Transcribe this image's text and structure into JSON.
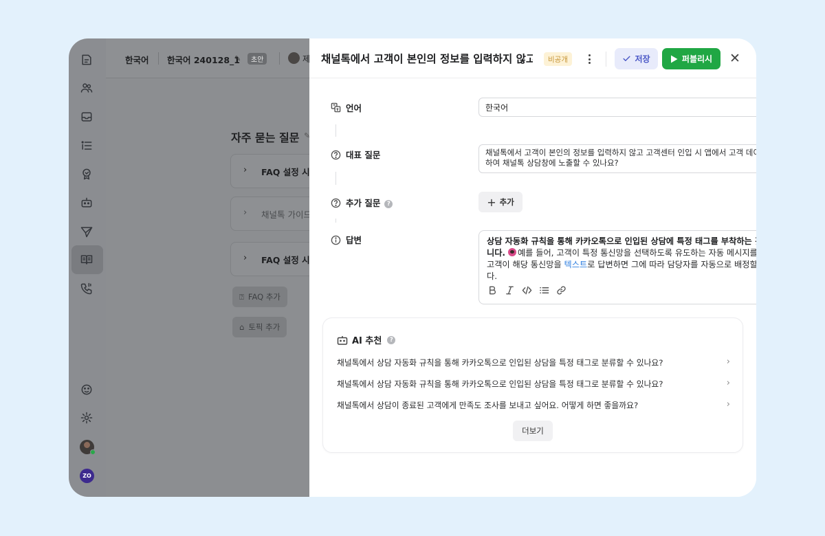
{
  "background_app": {
    "topbar": {
      "language": "한국어",
      "version": "한국어 240128_1",
      "draft_badge": "초안",
      "author_initial": "제"
    },
    "section_title": "자주 묻는 질문",
    "cards": [
      {
        "text": "FAQ 설정 시"
      },
      {
        "text": "채널톡 가이드"
      },
      {
        "text": "FAQ 설정 시"
      }
    ],
    "add_faq_label": "FAQ 추가",
    "add_topic_label": "토픽 추가",
    "nav_icons": [
      "notes-icon",
      "people-icon",
      "inbox-icon",
      "list-icon",
      "badge-icon",
      "bot-icon",
      "send-icon",
      "book-icon",
      "phone-icon",
      "face-icon",
      "settings-icon"
    ],
    "workspace_badge": "ZO"
  },
  "panel": {
    "title": "채널톡에서 고객이 본인의 정보를 입력하지 않고...",
    "visibility_badge": "비공개",
    "save_label": "저장",
    "publish_label": "퍼블리시",
    "language": {
      "label": "언어",
      "value": "한국어"
    },
    "representative_question": {
      "label": "대표 질문",
      "value": "채널톡에서 고객이 본인의 정보를 입력하지 않고 고객센터 인입 시 앱에서 고객 데이터를 전달하여 채널톡 상담창에 노출할 수 있나요?"
    },
    "additional_question": {
      "label": "추가 질문",
      "add_label": "추가"
    },
    "answer": {
      "label": "답변",
      "bold_text": "상담 자동화 규칙을 통해 카카오톡으로 인입된 상담에 특정 태그를 부착하는 것이 가능합니다.",
      "text_before_link": "예를 들어, 고객이 특정 통신망을 선택하도록 유도하는 자동 메시지를 설정하고, 고객이 해당 통신망을 ",
      "link_text": "텍스트",
      "text_after_link": "로 답변하면 그에 따라 담당자를 자동으로 배정할 수 있습니다.",
      "toolbar": [
        "B",
        "I",
        "code",
        "list",
        "link"
      ]
    },
    "ai_recommend": {
      "title": "AI 추천",
      "items": [
        "채널톡에서 상담 자동화 규칙을 통해 카카오톡으로 인입된 상담을 특정 태그로 분류할 수 있나요?",
        "채널톡에서 상담 자동화 규칙을 통해 카카오톡으로 인입된 상담을 특정 태그로 분류할 수 있나요?",
        "채널톡에서 상담이 종료된 고객에게 만족도 조사를 보내고 싶어요. 어떻게 하면 좋을까요?"
      ],
      "more_label": "더보기"
    }
  },
  "colors": {
    "page_background": "#e3f1fc",
    "publish": "#20a744",
    "save_bg": "#e8ebfb",
    "save_text": "#4a57c6",
    "private_badge_bg": "#fdf2d6",
    "private_badge_text": "#c7973a",
    "link": "#2f7fe0"
  }
}
